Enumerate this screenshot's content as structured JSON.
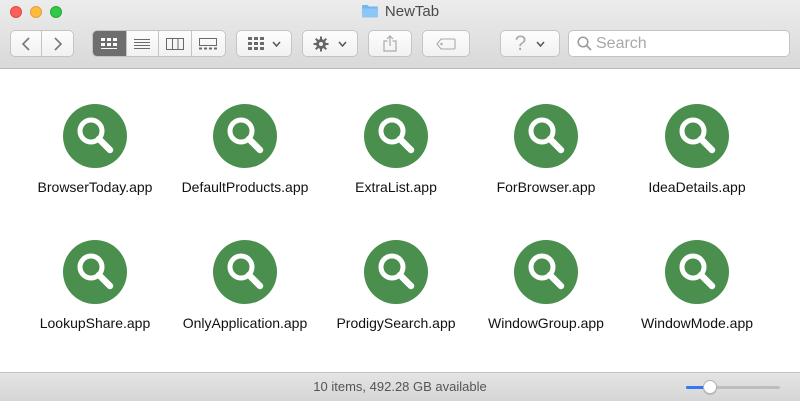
{
  "window": {
    "title": "NewTab",
    "folder_icon": "folder-icon"
  },
  "toolbar": {
    "nav": [
      {
        "name": "back-chevron-icon"
      },
      {
        "name": "forward-chevron-icon"
      }
    ],
    "view_modes": [
      {
        "name": "icon-view",
        "icon": "grid-icon",
        "active": true
      },
      {
        "name": "list-view",
        "icon": "list-icon",
        "active": false
      },
      {
        "name": "column-view",
        "icon": "columns-icon",
        "active": false
      },
      {
        "name": "gallery-view",
        "icon": "gallery-icon",
        "active": false
      }
    ],
    "group_menu_icon": "grid-icon",
    "action_menu_icon": "gear-icon",
    "share_icon": "share-icon",
    "tags_icon": "tag-icon",
    "help_glyph": "?"
  },
  "search": {
    "placeholder": "Search",
    "value": ""
  },
  "items": [
    {
      "label": "BrowserToday.app"
    },
    {
      "label": "DefaultProducts.app"
    },
    {
      "label": "ExtraList.app"
    },
    {
      "label": "ForBrowser.app"
    },
    {
      "label": "IdeaDetails.app"
    },
    {
      "label": "LookupShare.app"
    },
    {
      "label": "OnlyApplication.app"
    },
    {
      "label": "ProdigySearch.app"
    },
    {
      "label": "WindowGroup.app"
    },
    {
      "label": "WindowMode.app"
    }
  ],
  "app_icon": {
    "name": "magnifier-app-icon",
    "color": "#4a8f4d"
  },
  "status": {
    "text": "10 items, 492.28 GB available",
    "zoom_level": 0.25
  },
  "colors": {
    "accent": "#3478f6"
  }
}
